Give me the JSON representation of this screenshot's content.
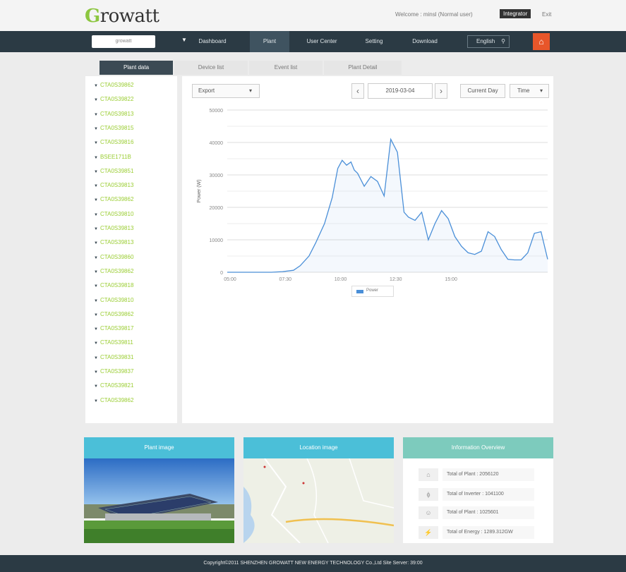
{
  "header": {
    "logo": "Growatt",
    "welcome": "Welcome : minsl (Normal user)",
    "role": "Integrator",
    "exit": "Exit"
  },
  "navbar": {
    "plant_select": "growatt",
    "items": [
      "Dashboard",
      "Plant",
      "User Center",
      "Setting",
      "Download"
    ],
    "language": "English"
  },
  "tabs": [
    "Plant data",
    "Device list",
    "Event list",
    "Plant Detail"
  ],
  "devices": [
    "CTA0S39862",
    "CTA0S39822",
    "CTA0S39813",
    "CTA0S39815",
    "CTA0S39816",
    "BSEE1711B",
    "CTA0S39851",
    "CTA0S39813",
    "CTA0S39862",
    "CTA0S39810",
    "CTA0S39813",
    "CTA0S39813",
    "CTA0S39860",
    "CTA0S39862",
    "CTA0S39818",
    "CTA0S39810",
    "CTA0S39862",
    "CTA0S39817",
    "CTA0S39811",
    "CTA0S39831",
    "CTA0S39837",
    "CTA0S39821",
    "CTA0S39862"
  ],
  "controls": {
    "export": "Export",
    "date": "2019-03-04",
    "current_day": "Current Day",
    "time": "Time"
  },
  "chart_data": {
    "type": "area",
    "title": "",
    "xlabel": "",
    "ylabel": "Power (W)",
    "xlim": [
      5,
      19.5
    ],
    "ylim": [
      0,
      50000
    ],
    "x_ticks": [
      "05:00",
      "07:30",
      "10:00",
      "12:30",
      "15:00"
    ],
    "y_ticks": [
      "0",
      "10000",
      "20000",
      "30000",
      "40000",
      "50000"
    ],
    "grid": true,
    "series": [
      {
        "name": "Power",
        "x": [
          5.0,
          7.0,
          7.5,
          8.0,
          8.3,
          8.7,
          9.0,
          9.4,
          9.75,
          10.0,
          10.2,
          10.4,
          10.6,
          10.75,
          10.9,
          11.2,
          11.5,
          11.8,
          12.1,
          12.4,
          12.7,
          13.0,
          13.2,
          13.5,
          13.8,
          14.1,
          14.4,
          14.7,
          15.0,
          15.3,
          15.6,
          15.9,
          16.2,
          16.5,
          16.8,
          17.1,
          17.4,
          17.7,
          18.0,
          18.3,
          18.6,
          18.9,
          19.2,
          19.5
        ],
        "values": [
          0,
          0,
          200,
          600,
          2000,
          5000,
          9000,
          15000,
          23000,
          32000,
          34500,
          33000,
          34000,
          31500,
          30500,
          26500,
          29500,
          28000,
          23500,
          41000,
          37000,
          18500,
          17000,
          16000,
          18500,
          10000,
          15000,
          19000,
          16500,
          11000,
          8000,
          6000,
          5500,
          6500,
          12500,
          11000,
          7000,
          4000,
          3800,
          3800,
          6000,
          12000,
          12500,
          4000
        ]
      }
    ],
    "legend": "bottom",
    "color": "#4a8fd8"
  },
  "cards": {
    "plant_image": {
      "title": "Plant image"
    },
    "location_image": {
      "title": "Location image"
    },
    "info": {
      "title": "Information Overview",
      "rows": [
        "Total of Plant : 2056120",
        "Total of Inverter : 1041100",
        "Total of Plant : 1025601",
        "Total of Energy : 1289.312GW"
      ]
    }
  },
  "footer": "Copyright©2011 SHENZHEN GROWATT NEW ENERGY TECHNOLOGY Co.,Ltd Site Server: 39:00",
  "colors": {
    "nav": "#2b3a44",
    "accent_green": "#8cc63f",
    "home": "#e8562a",
    "teal": "#4bbfd8",
    "mint": "#7dcbbd",
    "line": "#4a8fd8"
  }
}
